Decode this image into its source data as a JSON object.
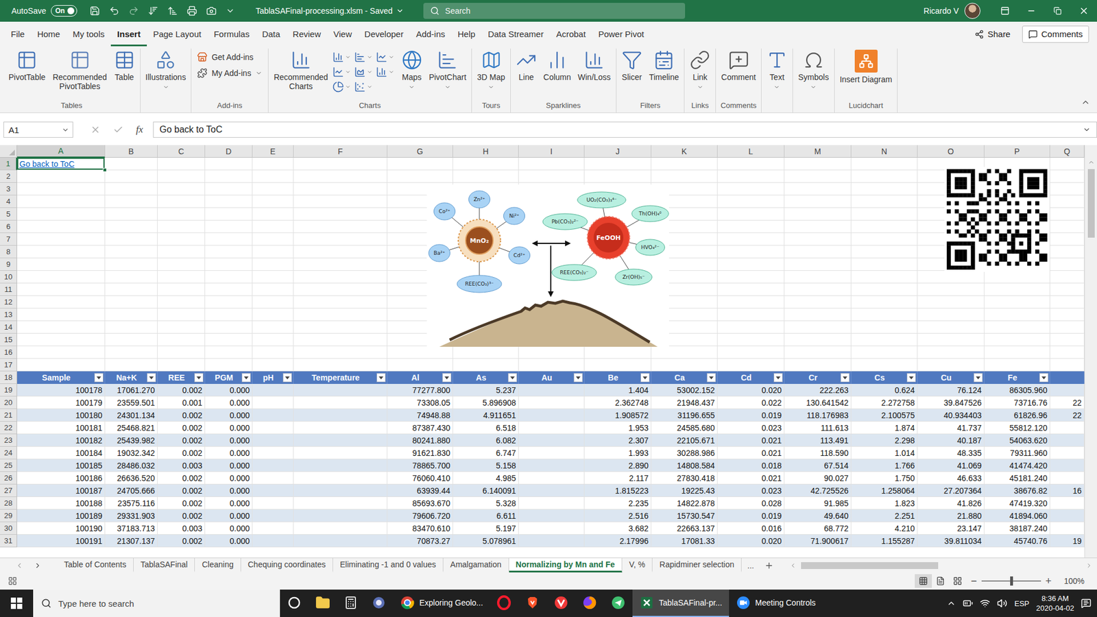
{
  "title_bar": {
    "autosave_label": "AutoSave",
    "autosave_state": "On",
    "autosave_on": true,
    "document_title": "TablaSAFinal-processing.xlsm - Saved",
    "search_placeholder": "Search",
    "user": "Ricardo V"
  },
  "ribbon_tabs": [
    {
      "label": "File",
      "selected": false
    },
    {
      "label": "Home",
      "selected": false
    },
    {
      "label": "My tools",
      "selected": false
    },
    {
      "label": "Insert",
      "selected": true
    },
    {
      "label": "Page Layout",
      "selected": false
    },
    {
      "label": "Formulas",
      "selected": false
    },
    {
      "label": "Data",
      "selected": false
    },
    {
      "label": "Review",
      "selected": false
    },
    {
      "label": "View",
      "selected": false
    },
    {
      "label": "Developer",
      "selected": false
    },
    {
      "label": "Add-ins",
      "selected": false
    },
    {
      "label": "Help",
      "selected": false
    },
    {
      "label": "Data Streamer",
      "selected": false
    },
    {
      "label": "Acrobat",
      "selected": false
    },
    {
      "label": "Power Pivot",
      "selected": false
    }
  ],
  "ribbon_actions": {
    "share": "Share",
    "comments": "Comments"
  },
  "ribbon_groups": [
    {
      "label": "Tables",
      "items": [
        {
          "label": "PivotTable",
          "kind": "large",
          "dropdown": false
        },
        {
          "label": "Recommended PivotTables",
          "kind": "large",
          "dropdown": false
        },
        {
          "label": "Table",
          "kind": "large",
          "dropdown": false
        }
      ]
    },
    {
      "items": [
        {
          "label": "Illustrations",
          "kind": "large",
          "dropdown": true
        }
      ]
    },
    {
      "label": "Add-ins",
      "items": [
        {
          "label": "Get Add-ins",
          "kind": "small",
          "dropdown": false
        },
        {
          "label": "My Add-ins",
          "kind": "small",
          "dropdown": true
        }
      ]
    },
    {
      "label": "Charts",
      "items": [
        {
          "label": "Recommended Charts",
          "kind": "large",
          "dropdown": false
        },
        {
          "kind": "cluster"
        },
        {
          "label": "Maps",
          "kind": "large",
          "dropdown": true
        },
        {
          "label": "PivotChart",
          "kind": "large",
          "dropdown": true
        }
      ]
    },
    {
      "label": "Tours",
      "items": [
        {
          "label": "3D Map",
          "kind": "large",
          "dropdown": true
        }
      ]
    },
    {
      "label": "Sparklines",
      "items": [
        {
          "label": "Line",
          "kind": "large",
          "dropdown": false
        },
        {
          "label": "Column",
          "kind": "large",
          "dropdown": false
        },
        {
          "label": "Win/Loss",
          "kind": "large",
          "dropdown": false
        }
      ]
    },
    {
      "label": "Filters",
      "items": [
        {
          "label": "Slicer",
          "kind": "large",
          "dropdown": false
        },
        {
          "label": "Timeline",
          "kind": "large",
          "dropdown": false
        }
      ]
    },
    {
      "label": "Links",
      "items": [
        {
          "label": "Link",
          "kind": "large",
          "dropdown": true
        }
      ]
    },
    {
      "label": "Comments",
      "items": [
        {
          "label": "Comment",
          "kind": "large",
          "dropdown": false
        }
      ]
    },
    {
      "items": [
        {
          "label": "Text",
          "kind": "large",
          "dropdown": true
        }
      ]
    },
    {
      "items": [
        {
          "label": "Symbols",
          "kind": "large",
          "dropdown": true
        }
      ]
    },
    {
      "label": "Lucidchart",
      "items": [
        {
          "label": "Insert Diagram",
          "kind": "large",
          "dropdown": false
        }
      ]
    }
  ],
  "formula_bar": {
    "name_box": "A1",
    "function_label": "fx",
    "content": "Go back to ToC"
  },
  "sheet": {
    "selected_cell": {
      "column": "A",
      "row": "1"
    },
    "columns": [
      "A",
      "B",
      "C",
      "D",
      "E",
      "F",
      "G",
      "H",
      "I",
      "J",
      "K",
      "L",
      "M",
      "N",
      "O",
      "P",
      "Q"
    ],
    "row_numbers": [
      "1",
      "2",
      "3",
      "4",
      "5",
      "6",
      "7",
      "8",
      "9",
      "10",
      "11",
      "12",
      "13",
      "14",
      "15",
      "16",
      "17",
      "18",
      "19",
      "20",
      "21",
      "22",
      "23",
      "24",
      "25",
      "26",
      "27",
      "28",
      "29",
      "30",
      "31"
    ],
    "link": {
      "row": "1",
      "column": "A",
      "text": "Go back to ToC"
    },
    "table": {
      "header_row": "18",
      "headers": [
        "Sample",
        "Na+K",
        "REE",
        "PGM",
        "pH",
        "Temperature",
        "Al",
        "As",
        "Au",
        "Be",
        "Ca",
        "Cd",
        "Cr",
        "Cs",
        "Cu",
        "Fe",
        ""
      ],
      "rows": [
        {
          "row": "19",
          "cells": [
            "100178",
            "17061.270",
            "0.002",
            "0.000",
            "",
            "",
            "77277.800",
            "5.237",
            "",
            "1.404",
            "53002.152",
            "0.020",
            "222.263",
            "0.624",
            "76.124",
            "86305.960",
            ""
          ]
        },
        {
          "row": "20",
          "cells": [
            "100179",
            "23559.501",
            "0.001",
            "0.000",
            "",
            "",
            "73308.05",
            "5.896908",
            "",
            "2.362748",
            "21948.437",
            "0.022",
            "130.641542",
            "2.272758",
            "39.847526",
            "73716.76",
            "22"
          ]
        },
        {
          "row": "21",
          "cells": [
            "100180",
            "24301.134",
            "0.002",
            "0.000",
            "",
            "",
            "74948.88",
            "4.911651",
            "",
            "1.908572",
            "31196.655",
            "0.019",
            "118.176983",
            "2.100575",
            "40.934403",
            "61826.96",
            "22"
          ]
        },
        {
          "row": "22",
          "cells": [
            "100181",
            "25468.821",
            "0.002",
            "0.000",
            "",
            "",
            "87387.430",
            "6.518",
            "",
            "1.953",
            "24585.680",
            "0.023",
            "111.613",
            "1.874",
            "41.737",
            "55812.120",
            ""
          ]
        },
        {
          "row": "23",
          "cells": [
            "100182",
            "25439.982",
            "0.002",
            "0.000",
            "",
            "",
            "80241.880",
            "6.082",
            "",
            "2.307",
            "22105.671",
            "0.021",
            "113.491",
            "2.298",
            "40.187",
            "54063.620",
            ""
          ]
        },
        {
          "row": "24",
          "cells": [
            "100184",
            "19032.342",
            "0.002",
            "0.000",
            "",
            "",
            "91621.830",
            "6.747",
            "",
            "1.993",
            "30288.986",
            "0.021",
            "118.590",
            "1.014",
            "48.335",
            "79311.960",
            ""
          ]
        },
        {
          "row": "25",
          "cells": [
            "100185",
            "28486.032",
            "0.003",
            "0.000",
            "",
            "",
            "78865.700",
            "5.158",
            "",
            "2.890",
            "14808.584",
            "0.018",
            "67.514",
            "1.766",
            "41.069",
            "41474.420",
            ""
          ]
        },
        {
          "row": "26",
          "cells": [
            "100186",
            "26636.520",
            "0.002",
            "0.000",
            "",
            "",
            "76060.410",
            "4.985",
            "",
            "2.117",
            "27830.418",
            "0.021",
            "90.027",
            "1.750",
            "46.633",
            "45181.240",
            ""
          ]
        },
        {
          "row": "27",
          "cells": [
            "100187",
            "24705.666",
            "0.002",
            "0.000",
            "",
            "",
            "63939.44",
            "6.140091",
            "",
            "1.815223",
            "19225.43",
            "0.023",
            "42.725526",
            "1.258064",
            "27.207364",
            "38676.82",
            "16"
          ]
        },
        {
          "row": "28",
          "cells": [
            "100188",
            "23575.116",
            "0.002",
            "0.000",
            "",
            "",
            "85693.670",
            "5.328",
            "",
            "2.235",
            "14822.878",
            "0.028",
            "91.985",
            "1.823",
            "41.826",
            "47419.320",
            ""
          ]
        },
        {
          "row": "29",
          "cells": [
            "100189",
            "29331.903",
            "0.002",
            "0.000",
            "",
            "",
            "79606.720",
            "6.611",
            "",
            "2.516",
            "15730.547",
            "0.019",
            "49.640",
            "2.251",
            "21.880",
            "41894.060",
            ""
          ]
        },
        {
          "row": "30",
          "cells": [
            "100190",
            "37183.713",
            "0.003",
            "0.000",
            "",
            "",
            "83470.610",
            "5.197",
            "",
            "3.682",
            "22663.137",
            "0.016",
            "68.772",
            "4.210",
            "23.147",
            "38187.240",
            ""
          ]
        },
        {
          "row": "31",
          "cells": [
            "100191",
            "21307.137",
            "0.002",
            "0.000",
            "",
            "",
            "70873.27",
            "5.078961",
            "",
            "2.17996",
            "17081.33",
            "0.020",
            "71.900617",
            "1.155287",
            "39.811034",
            "45740.76",
            "19"
          ]
        }
      ]
    },
    "diagram": {
      "mn_core": "MnO₂",
      "fe_core": "FeOOH",
      "mn_ions": [
        "Zn²⁺",
        "Co²⁺",
        "Ni²⁺",
        "Ba²⁺",
        "Cd²⁺",
        "REE(CO₃)³⁻"
      ],
      "fe_ions": [
        "UO₂(CO₃)₃⁴⁻",
        "Th(OH)₄⁰",
        "Pb(CO₃)₂²⁻",
        "HVO₄²⁻",
        "REE(CO₃)₂⁻",
        "Zr(OH)₅⁻"
      ]
    }
  },
  "sheet_tabs": [
    {
      "label": "Table of Contents",
      "selected": false
    },
    {
      "label": "TablaSAFinal",
      "selected": false
    },
    {
      "label": "Cleaning",
      "selected": false
    },
    {
      "label": "Chequing coordinates",
      "selected": false
    },
    {
      "label": "Eliminating -1 and 0 values",
      "selected": false
    },
    {
      "label": "Amalgamation",
      "selected": false
    },
    {
      "label": "Normalizing by Mn and Fe",
      "selected": true
    },
    {
      "label": "V, %",
      "selected": false
    },
    {
      "label": "Rapidminer selection",
      "selected": false
    }
  ],
  "sheet_tabs_more": "...",
  "status_bar": {
    "zoom_out": "−",
    "zoom_in": "+",
    "zoom_level": 0.5,
    "zoom_reading": "100%"
  },
  "taskbar": {
    "search_placeholder": "Type here to search",
    "apps": [
      {
        "kind": "cortana",
        "active": false
      },
      {
        "kind": "explorer",
        "active": false
      },
      {
        "kind": "calculator",
        "active": false
      },
      {
        "kind": "snip",
        "active": false
      },
      {
        "kind": "chrome",
        "label": "Exploring Geolo...",
        "active": false
      },
      {
        "kind": "opera",
        "active": false
      },
      {
        "kind": "brave",
        "active": false
      },
      {
        "kind": "vivaldi",
        "active": false
      },
      {
        "kind": "firefox",
        "active": false
      },
      {
        "kind": "telegram",
        "active": false
      },
      {
        "kind": "excel",
        "label": "TablaSAFinal-pr...",
        "active": true
      },
      {
        "kind": "zoom",
        "label": "Meeting Controls",
        "active": false
      }
    ],
    "language": "ESP",
    "time": "8:36 AM",
    "date": "2020-04-02"
  }
}
